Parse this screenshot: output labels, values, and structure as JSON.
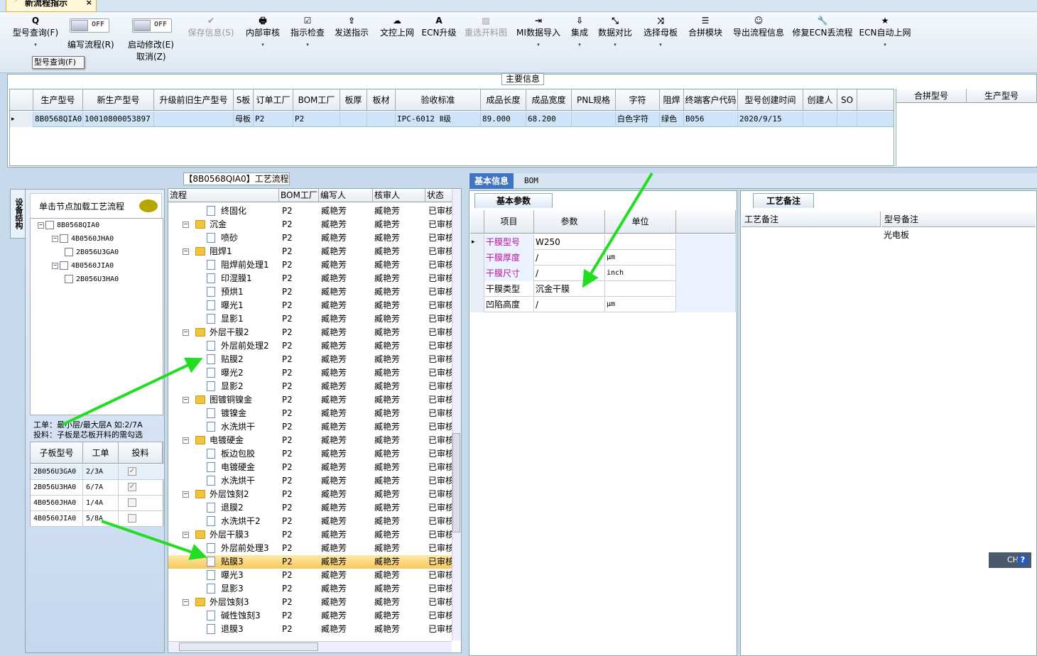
{
  "window": {
    "tab_title": "新流程指示",
    "close": "×"
  },
  "ribbon": {
    "buttons": [
      {
        "label": "型号查询(F)",
        "icon": "Q",
        "dd": "▾"
      },
      {
        "label": "保存信息(S)",
        "icon": "✔"
      },
      {
        "label": "内部审核",
        "icon": "🖶",
        "dd": "▾"
      },
      {
        "label": "指示检查",
        "icon": "☑",
        "dd": "▾"
      },
      {
        "label": "发送指示",
        "icon": "⇪"
      },
      {
        "label": "文控上网",
        "icon": "☁"
      },
      {
        "label": "ECN升级",
        "icon": "A"
      },
      {
        "label": "重选开料图",
        "icon": "▨"
      },
      {
        "label": "MI数据导入",
        "icon": "⇥",
        "dd": "▾"
      },
      {
        "label": "集成",
        "icon": "⇩",
        "dd": "▾"
      },
      {
        "label": "数据对比",
        "icon": "⤡",
        "dd": "▾"
      },
      {
        "label": "选择母板",
        "icon": "⤨",
        "dd": "▾"
      },
      {
        "label": "合拼模块",
        "icon": "☰"
      },
      {
        "label": "导出流程信息",
        "icon": "☺"
      },
      {
        "label": "修复ECN丢流程",
        "icon": "🔧"
      },
      {
        "label": "ECN自动上网",
        "icon": "★",
        "dd": "▾"
      }
    ],
    "toggle1": {
      "state": "OFF",
      "label": "编写流程(R)"
    },
    "toggle2": {
      "state": "OFF",
      "label": "启动修改(E)",
      "label2": "取消(Z)"
    },
    "tooltip": "型号查询(F)"
  },
  "main_info": {
    "title": "主要信息",
    "columns": [
      "生产型号",
      "新生产型号",
      "升级前旧生产型号",
      "S板",
      "订单工厂",
      "BOM工厂",
      "板厚",
      "板材",
      "验收标准",
      "成品长度",
      "成品宽度",
      "PNL规格",
      "字符",
      "阻焊",
      "终端客户代码",
      "型号创建时间",
      "创建人",
      "SO"
    ],
    "row": [
      "8B0568QIA0",
      "10010800053897",
      "",
      "母板",
      "P2",
      "P2",
      "",
      "",
      "IPC-6012 Ⅱ级",
      "89.000",
      "68.200",
      "",
      "白色字符",
      "绿色",
      "B056",
      "2020/9/15",
      "",
      ""
    ],
    "merge_columns": [
      "合拼型号",
      "生产型号"
    ]
  },
  "left": {
    "vertical_tab": "设备结构",
    "click_tip": "单击节点加载工艺流程",
    "tree": [
      "8B0568QIA0",
      "4B0560JHA0",
      "2B056U3GA0",
      "4B0560JIA0",
      "2B056U3HA0"
    ],
    "hint1": "工单：最小层/最大层A 如:2/7A",
    "hint2": "投料：子板是芯板开料的需勾选",
    "sub_columns": [
      "子板型号",
      "工单",
      "投料"
    ],
    "sub_rows": [
      {
        "model": "2B056U3GA0",
        "order": "2/3A",
        "checked": "✓"
      },
      {
        "model": "2B056U3HA0",
        "order": "6/7A",
        "checked": "✓"
      },
      {
        "model": "4B0560JHA0",
        "order": "1/4A",
        "checked": ""
      },
      {
        "model": "4B0560JIA0",
        "order": "5/8A",
        "checked": ""
      }
    ]
  },
  "flow": {
    "title": "【8B0568QIA0】工艺流程",
    "columns": [
      "流程",
      "BOM工厂",
      "编写人",
      "核审人",
      "状态"
    ],
    "factory": "P2",
    "writer": "臧艳芳",
    "reviewer": "臧艳芳",
    "status": "已审核",
    "rows": [
      {
        "name": "终固化",
        "lvl": 2
      },
      {
        "name": "沉金",
        "lvl": 1
      },
      {
        "name": "喷砂",
        "lvl": 2
      },
      {
        "name": "阻焊1",
        "lvl": 1
      },
      {
        "name": "阻焊前处理1",
        "lvl": 2
      },
      {
        "name": "印湿膜1",
        "lvl": 2
      },
      {
        "name": "预烘1",
        "lvl": 2
      },
      {
        "name": "曝光1",
        "lvl": 2
      },
      {
        "name": "显影1",
        "lvl": 2
      },
      {
        "name": "外层干膜2",
        "lvl": 1
      },
      {
        "name": "外层前处理2",
        "lvl": 2
      },
      {
        "name": "贴膜2",
        "lvl": 2
      },
      {
        "name": "曝光2",
        "lvl": 2
      },
      {
        "name": "显影2",
        "lvl": 2
      },
      {
        "name": "图镀铜镍金",
        "lvl": 1
      },
      {
        "name": "镀镍金",
        "lvl": 2
      },
      {
        "name": "水洗烘干",
        "lvl": 2
      },
      {
        "name": "电镀硬金",
        "lvl": 1
      },
      {
        "name": "板边包胶",
        "lvl": 2
      },
      {
        "name": "电镀硬金",
        "lvl": 2
      },
      {
        "name": "水洗烘干",
        "lvl": 2
      },
      {
        "name": "外层蚀刻2",
        "lvl": 1
      },
      {
        "name": "退膜2",
        "lvl": 2
      },
      {
        "name": "水洗烘干2",
        "lvl": 2
      },
      {
        "name": "外层干膜3",
        "lvl": 1
      },
      {
        "name": "外层前处理3",
        "lvl": 2
      },
      {
        "name": "贴膜3",
        "lvl": 2,
        "sel": true
      },
      {
        "name": "曝光3",
        "lvl": 2
      },
      {
        "name": "显影3",
        "lvl": 2
      },
      {
        "name": "外层蚀刻3",
        "lvl": 1
      },
      {
        "name": "碱性蚀刻3",
        "lvl": 2
      },
      {
        "name": "退膜3",
        "lvl": 2
      }
    ]
  },
  "basic": {
    "tab_basic": "基本信息",
    "tab_bom": "BOM",
    "params_tab": "基本参数",
    "columns": [
      "项目",
      "参数",
      "单位"
    ],
    "rows": [
      {
        "item": "干膜型号",
        "value": "W250",
        "unit": "",
        "pink": true
      },
      {
        "item": "干膜厚度",
        "value": "/",
        "unit": "μm",
        "pink": true
      },
      {
        "item": "干膜尺寸",
        "value": "/",
        "unit": "inch",
        "pink": true
      },
      {
        "item": "干膜类型",
        "value": "沉金干膜",
        "unit": "",
        "pink": false
      },
      {
        "item": "凹陷高度",
        "value": "/",
        "unit": "μm",
        "pink": false
      }
    ]
  },
  "notes": {
    "tab": "工艺备注",
    "col1": "工艺备注",
    "col2": "型号备注",
    "model_note": "光电板"
  },
  "ime": {
    "lang": "CH",
    "help": "?"
  },
  "colors": {
    "accent": "#3e74c0",
    "selection": "#f8c85a",
    "arrow": "#22dd22",
    "pink": "#c0129a"
  }
}
